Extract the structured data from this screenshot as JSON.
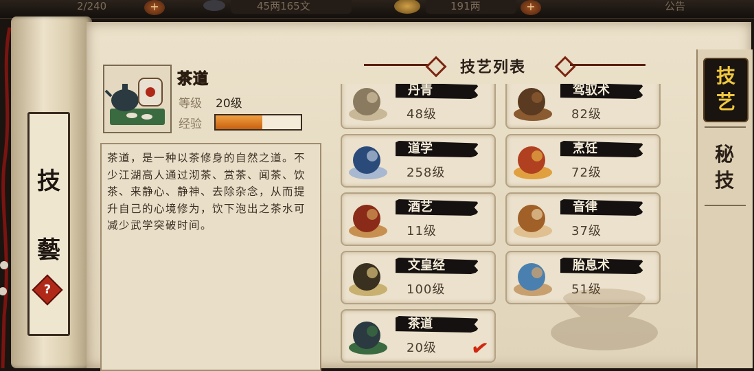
{
  "topbar": {
    "stamina": "2/240",
    "money": "45两165文",
    "gold": "191两",
    "notice_label": "公告"
  },
  "sidebar": {
    "char1": "技",
    "char2": "藝",
    "help_label": "?"
  },
  "detail": {
    "name": "茶道",
    "level_label": "等级",
    "level_value": "20级",
    "exp_label": "经验",
    "exp_fraction": 0.55,
    "description": "茶道，是一种以茶修身的自然之道。不少江湖高人通过沏茶、赏茶、闻茶、饮茶、来静心、静神、去除杂念，从而提升自己的心境修为，饮下泡出之茶水可减少武学突破时间。"
  },
  "list": {
    "title": "技艺列表",
    "skills": [
      {
        "name": "丹青",
        "level": "48级",
        "icon": "painting-scroll-icon"
      },
      {
        "name": "驾驭术",
        "level": "82级",
        "icon": "horse-icon"
      },
      {
        "name": "道学",
        "level": "258级",
        "icon": "taoist-book-icon"
      },
      {
        "name": "烹饪",
        "level": "72级",
        "icon": "cooking-dish-icon"
      },
      {
        "name": "酒艺",
        "level": "11级",
        "icon": "wine-jar-icon"
      },
      {
        "name": "音律",
        "level": "37级",
        "icon": "pipa-instrument-icon"
      },
      {
        "name": "文皇经",
        "level": "100级",
        "icon": "scripture-book-icon"
      },
      {
        "name": "胎息术",
        "level": "51级",
        "icon": "meditating-monk-icon"
      },
      {
        "name": "茶道",
        "level": "20级",
        "icon": "tea-set-icon",
        "selected": true
      }
    ]
  },
  "tabs": {
    "active": "技艺",
    "inactive": "秘技"
  },
  "colors": {
    "parchment": "#e7dcc4",
    "accent_gold": "#f0d34a",
    "exp_orange": "#e07820",
    "check_red": "#d02810"
  }
}
